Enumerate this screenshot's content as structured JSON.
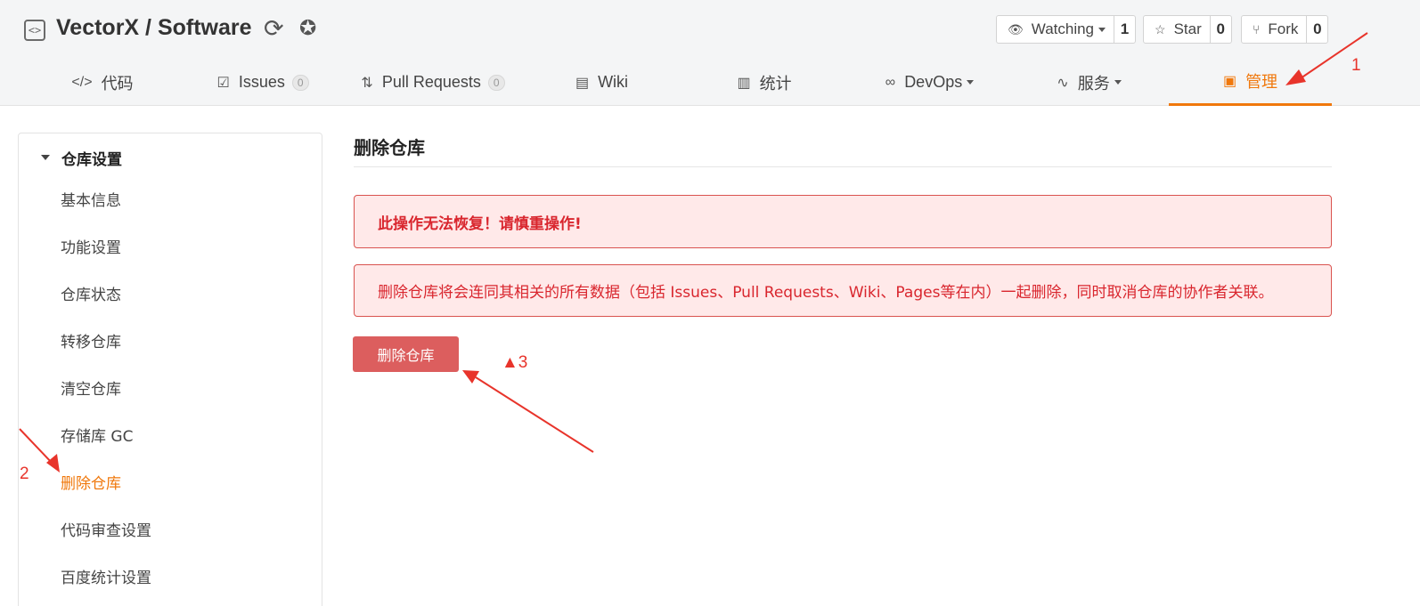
{
  "header": {
    "repo_title": "VectorX / Software",
    "repo_icon": "code-brackets-icon",
    "actions": {
      "watch_label": "Watching",
      "watch_count": "1",
      "star_label": "Star",
      "star_count": "0",
      "fork_label": "Fork",
      "fork_count": "0"
    }
  },
  "tabs": {
    "code": "代码",
    "issues": "Issues",
    "issues_count": "0",
    "pulls": "Pull Requests",
    "pulls_count": "0",
    "wiki": "Wiki",
    "stats": "统计",
    "devops": "DevOps",
    "services": "服务",
    "manage": "管理"
  },
  "sidebar": {
    "heading": "仓库设置",
    "items": [
      "基本信息",
      "功能设置",
      "仓库状态",
      "转移仓库",
      "清空仓库",
      "存储库 GC",
      "删除仓库",
      "代码审查设置",
      "百度统计设置"
    ]
  },
  "main": {
    "title": "删除仓库",
    "warning": "此操作无法恢复！请慎重操作!",
    "description": "删除仓库将会连同其相关的所有数据（包括 Issues、Pull Requests、Wiki、Pages等在内）一起删除，同时取消仓库的协作者关联。",
    "delete_button": "删除仓库"
  },
  "annotations": {
    "one": "1",
    "two": "2",
    "three": "▲3"
  },
  "colors": {
    "accent": "#f0780c",
    "danger": "#d9262e",
    "danger_button": "#dc5e5e",
    "annotation": "#e8342b"
  }
}
